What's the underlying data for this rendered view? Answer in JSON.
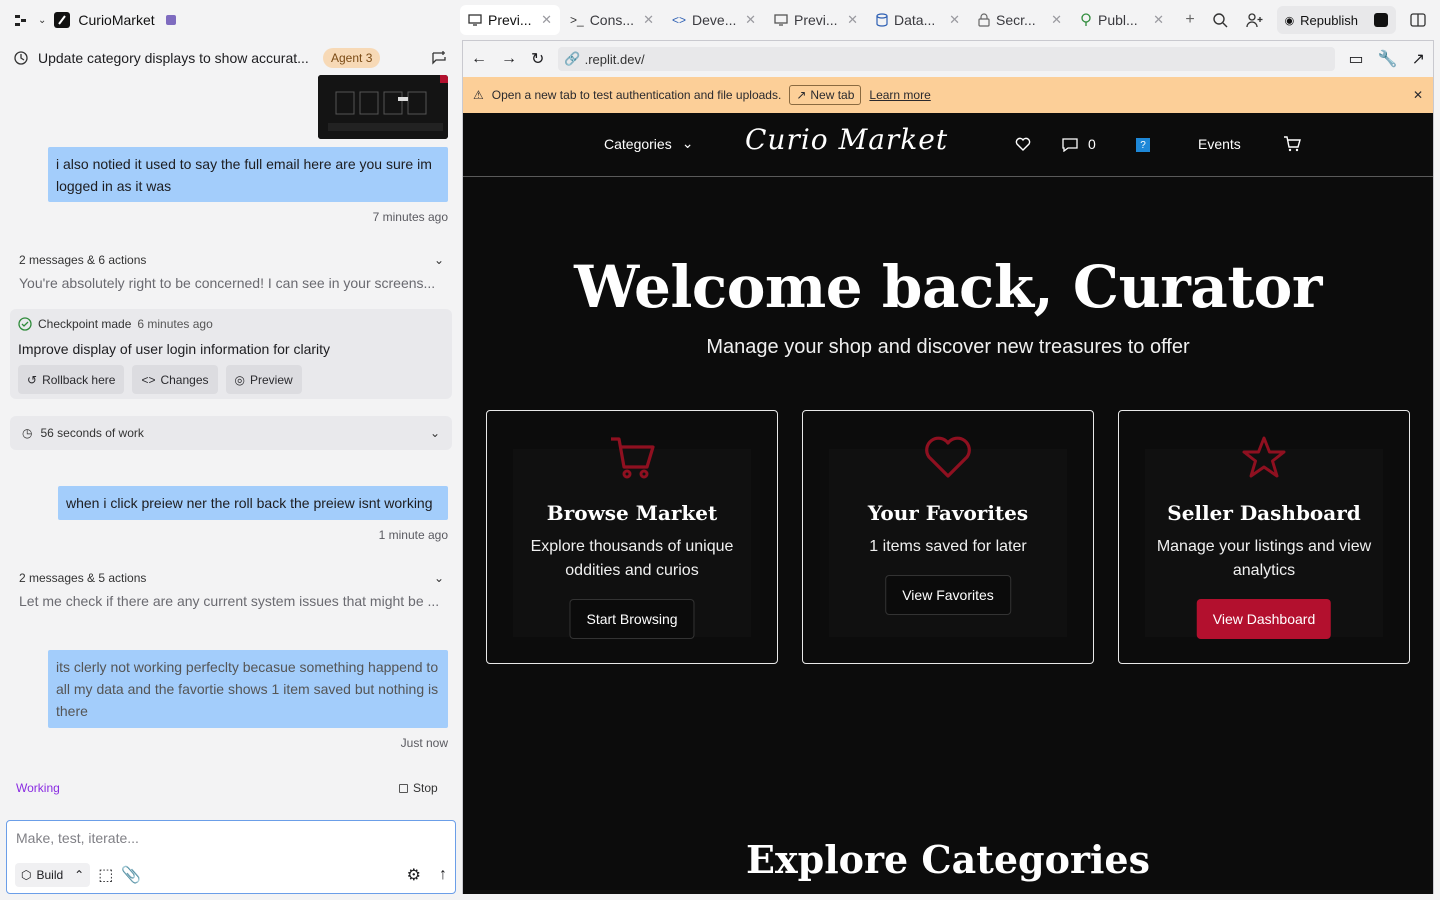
{
  "app": {
    "name": "CurioMarket"
  },
  "tabs": [
    {
      "label": "Previ...",
      "icon": "monitor-icon"
    },
    {
      "label": "Cons...",
      "icon": "terminal-icon"
    },
    {
      "label": "Deve...",
      "icon": "code-icon"
    },
    {
      "label": "Previ...",
      "icon": "monitor-icon"
    },
    {
      "label": "Data...",
      "icon": "database-icon"
    },
    {
      "label": "Secr...",
      "icon": "lock-icon"
    },
    {
      "label": "Publ...",
      "icon": "tree-icon"
    }
  ],
  "toolbar": {
    "republish_label": "Republish"
  },
  "chat": {
    "title": "Update category displays to show accurat...",
    "agent_badge": "Agent 3",
    "messages": [
      {
        "text": "i also notied it used to say the full email here are you sure im logged in as it was",
        "time": "7 minutes ago"
      },
      {
        "text": "when i click preiew ner the roll back the preiew isnt working",
        "time": "1 minute ago"
      },
      {
        "text": "its clerly not working perfeclty becasue something happend to all my data and the favortie shows 1 item saved but nothing is there",
        "time": "Just now"
      }
    ],
    "summaries": [
      {
        "meta": "2 messages & 6 actions",
        "text": "You're absolutely right to be concerned! I can see in your screens..."
      },
      {
        "meta": "2 messages & 5 actions",
        "text": "Let me check if there are any current system issues that might be ..."
      }
    ],
    "checkpoint": {
      "label": "Checkpoint made",
      "time": "6 minutes ago",
      "title": "Improve display of user login information for clarity",
      "actions": [
        "Rollback here",
        "Changes",
        "Preview"
      ]
    },
    "work": "56 seconds of work",
    "status": "Working",
    "stop_label": "Stop",
    "composer": {
      "placeholder": "Make, test, iterate...",
      "mode": "Build"
    }
  },
  "preview": {
    "url": ".replit.dev/",
    "banner": {
      "text": "Open a new tab to test authentication and file uploads.",
      "new_tab": "New tab",
      "learn_more": "Learn more"
    },
    "site": {
      "nav": {
        "categories": "Categories",
        "logo_curio": "Curio",
        "logo_market": "Market",
        "messages_count": "0",
        "avatar_glyph": "?",
        "events": "Events"
      },
      "hero_title": "Welcome back, Curator",
      "hero_subtitle": "Manage your shop and discover new treasures to offer",
      "cards": [
        {
          "title": "Browse Market",
          "desc": "Explore thousands of unique oddities and curios",
          "button": "Start Browsing",
          "icon": "cart-icon"
        },
        {
          "title": "Your Favorites",
          "desc": "1 items saved for later",
          "button": "View Favorites",
          "icon": "heart-icon"
        },
        {
          "title": "Seller Dashboard",
          "desc": "Manage your listings and view analytics",
          "button": "View Dashboard",
          "icon": "star-icon"
        }
      ],
      "section_title": "Explore Categories"
    }
  },
  "colors": {
    "accent_red": "#b3102e",
    "icon_red": "#8f1020",
    "bubble": "#a3cdfb",
    "banner": "#fccf98",
    "working": "#8a2be2"
  }
}
